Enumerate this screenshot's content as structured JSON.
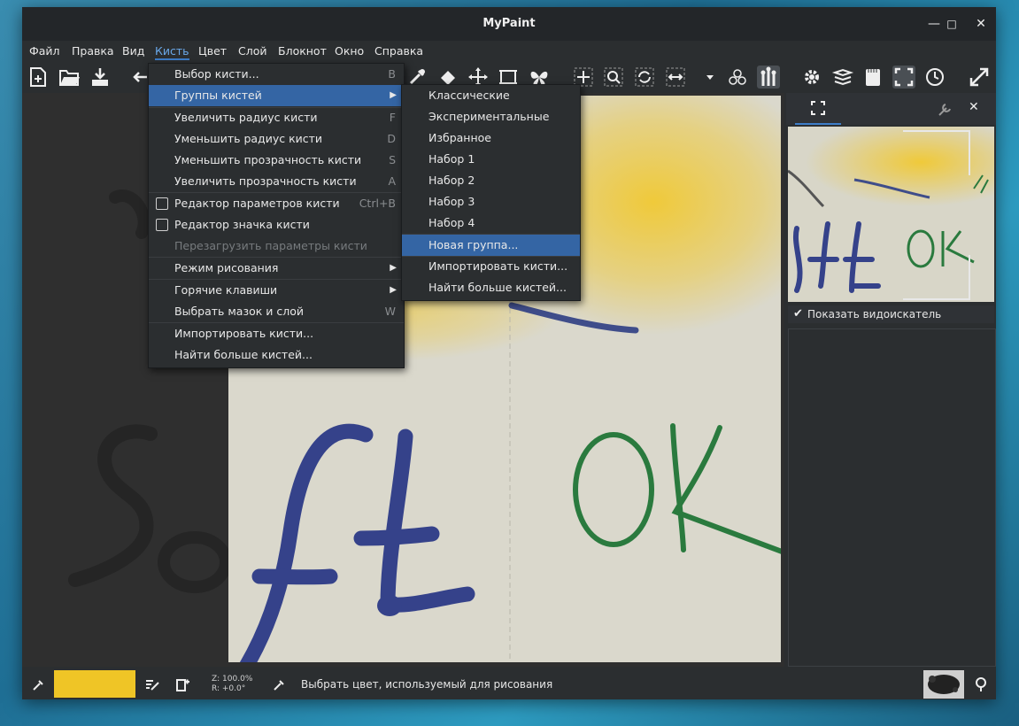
{
  "window": {
    "title": "MyPaint"
  },
  "menubar": [
    "Файл",
    "Правка",
    "Вид",
    "Кисть",
    "Цвет",
    "Слой",
    "Блокнот",
    "Окно",
    "Справка"
  ],
  "brush_menu": {
    "items": [
      {
        "label": "Выбор кисти...",
        "shortcut": "B"
      },
      {
        "label": "Группы кистей",
        "shortcut": ""
      },
      {
        "label": "Увеличить радиус кисти",
        "shortcut": "F"
      },
      {
        "label": "Уменьшить радиус кисти",
        "shortcut": "D"
      },
      {
        "label": "Уменьшить прозрачность кисти",
        "shortcut": "S"
      },
      {
        "label": "Увеличить прозрачность кисти",
        "shortcut": "A"
      },
      {
        "label": "Редактор параметров кисти",
        "shortcut": "Ctrl+B"
      },
      {
        "label": "Редактор значка кисти",
        "shortcut": ""
      },
      {
        "label": "Перезагрузить параметры кисти",
        "shortcut": ""
      },
      {
        "label": "Режим рисования",
        "shortcut": ""
      },
      {
        "label": "Горячие клавиши",
        "shortcut": ""
      },
      {
        "label": "Выбрать мазок и слой",
        "shortcut": "W"
      },
      {
        "label": "Импортировать кисти...",
        "shortcut": ""
      },
      {
        "label": "Найти больше кистей...",
        "shortcut": ""
      }
    ]
  },
  "groups_submenu": {
    "items": [
      "Классические",
      "Экспериментальные",
      "Избранное",
      "Набор 1",
      "Набор 2",
      "Набор 3",
      "Набор 4",
      "Новая группа...",
      "Импортировать кисти...",
      "Найти больше кистей..."
    ]
  },
  "side_panel": {
    "show_finder_label": "Показать видоискатель",
    "show_finder_checked": true
  },
  "status": {
    "zoom": "Z: 100.0%",
    "rotation": "R: +0.0°",
    "message": "Выбрать цвет, используемый для рисования",
    "color": "#efc526"
  },
  "canvas_text": {
    "soft": "Soft",
    "ok": "OK"
  }
}
